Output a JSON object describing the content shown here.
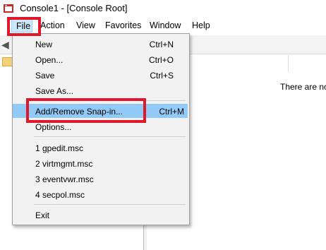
{
  "window": {
    "title": "Console1 - [Console Root]"
  },
  "menubar": {
    "items": [
      "File",
      "Action",
      "View",
      "Favorites",
      "Window",
      "Help"
    ]
  },
  "main": {
    "empty_message": "There are no"
  },
  "file_menu": {
    "items": [
      {
        "label": "New",
        "shortcut": "Ctrl+N"
      },
      {
        "label": "Open...",
        "shortcut": "Ctrl+O"
      },
      {
        "label": "Save",
        "shortcut": "Ctrl+S"
      },
      {
        "label": "Save As...",
        "shortcut": ""
      },
      {
        "label": "Add/Remove Snap-in...",
        "shortcut": "Ctrl+M"
      },
      {
        "label": "Options...",
        "shortcut": ""
      },
      {
        "label": "1 gpedit.msc",
        "shortcut": ""
      },
      {
        "label": "2 virtmgmt.msc",
        "shortcut": ""
      },
      {
        "label": "3 eventvwr.msc",
        "shortcut": ""
      },
      {
        "label": "4 secpol.msc",
        "shortcut": ""
      },
      {
        "label": "Exit",
        "shortcut": ""
      }
    ],
    "selected_item": "Add/Remove Snap-in..."
  },
  "colors": {
    "highlight_box": "#e0182b",
    "selected_bg": "#91c9f7",
    "menu_bg": "#f2f2f2"
  },
  "icons": {
    "app": "mmc-console-icon",
    "back": "back-arrow-icon",
    "folder": "folder-icon"
  }
}
